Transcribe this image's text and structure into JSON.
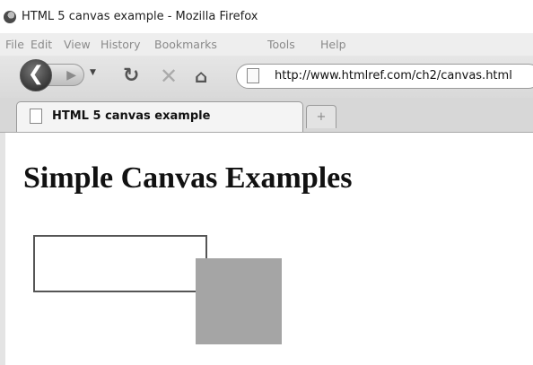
{
  "window": {
    "title": "HTML 5 canvas example - Mozilla Firefox"
  },
  "menu": [
    "File",
    "Edit",
    "View",
    "History",
    "Bookmarks",
    "Tools",
    "Help"
  ],
  "nav": {
    "url": "http://www.htmlref.com/ch2/canvas.html"
  },
  "tabs": [
    {
      "label": "HTML 5 canvas example"
    }
  ],
  "new_tab_symbol": "+",
  "page": {
    "heading": "Simple Canvas Examples"
  },
  "canvas": {
    "shapes": [
      {
        "kind": "stroke-rectangle",
        "color": "#555555"
      },
      {
        "kind": "filled-rectangle",
        "color": "#a5a5a5"
      }
    ]
  },
  "icons": {
    "back": "back-arrow-icon",
    "forward": "forward-arrow-icon",
    "reload": "reload-icon",
    "stop": "stop-icon",
    "home": "home-icon"
  }
}
